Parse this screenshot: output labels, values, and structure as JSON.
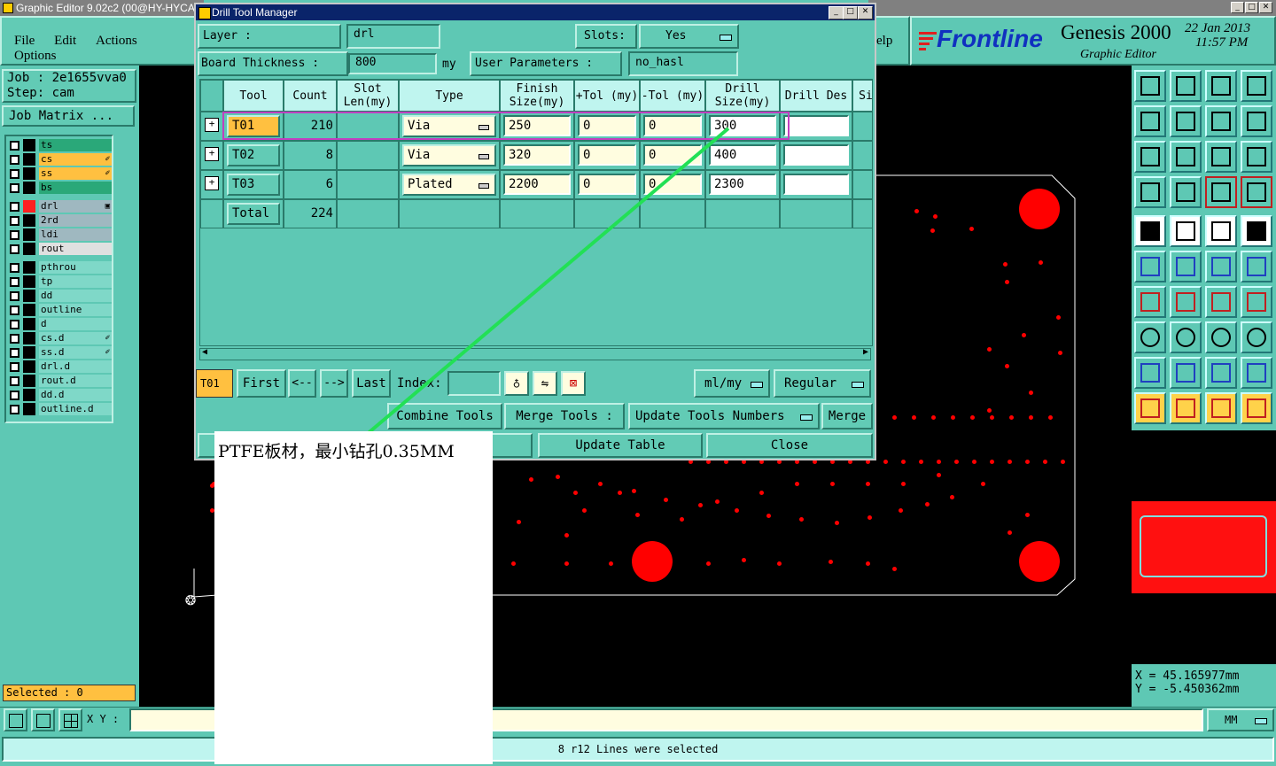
{
  "app": {
    "title": "Graphic Editor 9.02c2 (00@HY-HYCA",
    "menu": [
      "File",
      "Edit",
      "Actions",
      "Options"
    ],
    "help_partial": "elp",
    "brand": "Frontline",
    "product": "Genesis 2000",
    "subtitle": "Graphic Editor",
    "date": "22 Jan 2013",
    "time": "11:57 PM"
  },
  "job": {
    "job_label": "Job : 2e1655vva0",
    "step_label": "Step: cam",
    "matrix_button": "Job Matrix ..."
  },
  "layers_group1": [
    {
      "name": "ts",
      "color": "#2aa879",
      "mark": ""
    },
    {
      "name": "cs",
      "color": "#ffc040",
      "mark": "✐"
    },
    {
      "name": "ss",
      "color": "#ffc040",
      "mark": "✐"
    },
    {
      "name": "bs",
      "color": "#2aa879",
      "mark": ""
    }
  ],
  "layers_group2": [
    {
      "name": "drl",
      "color": "#9fb8c0",
      "mark": "▣"
    },
    {
      "name": "2rd",
      "color": "#9fb8c0",
      "mark": ""
    },
    {
      "name": "ldi",
      "color": "#9fb8c0",
      "mark": ""
    },
    {
      "name": "rout",
      "color": "#e0e0e0",
      "mark": ""
    }
  ],
  "layers_group3": [
    {
      "name": "pthrou",
      "mark": ""
    },
    {
      "name": "tp",
      "mark": ""
    },
    {
      "name": "dd",
      "mark": ""
    },
    {
      "name": "outline",
      "mark": ""
    },
    {
      "name": "d",
      "mark": ""
    },
    {
      "name": "cs.d",
      "mark": "✐"
    },
    {
      "name": "ss.d",
      "mark": "✐"
    },
    {
      "name": "drl.d",
      "mark": ""
    },
    {
      "name": "rout.d",
      "mark": ""
    },
    {
      "name": "dd.d",
      "mark": ""
    },
    {
      "name": "outline.d",
      "mark": ""
    }
  ],
  "selected_label": "Selected : 0",
  "bottom": {
    "xy_label": "X Y :",
    "status": "8 r12 Lines were selected",
    "units": "MM"
  },
  "coords": {
    "x": "X = 45.165977mm",
    "y": "Y = -5.450362mm"
  },
  "dialog": {
    "title": "Drill Tool Manager",
    "layer_label": "Layer :",
    "layer_value": "drl",
    "slots_label": "Slots:",
    "slots_value": "Yes",
    "thickness_label": "Board Thickness :",
    "thickness_value": "800",
    "thickness_unit": "my",
    "user_params_label": "User Parameters :",
    "user_params_value": "no_hasl",
    "columns": [
      "Tool",
      "Count",
      "Slot Len(my)",
      "Type",
      "Finish Size(my)",
      "+Tol (my)",
      "-Tol (my)",
      "Drill Size(my)",
      "Drill Des",
      "Si"
    ],
    "rows": [
      {
        "tool": "T01",
        "count": "210",
        "type": "Via",
        "finish": "250",
        "ptol": "0",
        "mtol": "0",
        "drill": "300",
        "des": ""
      },
      {
        "tool": "T02",
        "count": "8",
        "type": "Via",
        "finish": "320",
        "ptol": "0",
        "mtol": "0",
        "drill": "400",
        "des": ""
      },
      {
        "tool": "T03",
        "count": "6",
        "type": "Plated",
        "finish": "2200",
        "ptol": "0",
        "mtol": "0",
        "drill": "2300",
        "des": ""
      }
    ],
    "total_label": "Total",
    "total_count": "224",
    "nav": {
      "current": "T01",
      "first": "First",
      "prev": "<--",
      "next": "-->",
      "last": "Last",
      "index_label": "Index:",
      "units": "ml/my",
      "mode": "Regular"
    },
    "combine_tools": "Combine Tools",
    "merge_tools_label": "Merge Tools :",
    "update_numbers": "Update Tools Numbers",
    "merge": "Merge",
    "update_table": "Update Table",
    "close": "Close"
  },
  "annotation": "PTFE板材，最小钻孔0.35MM"
}
